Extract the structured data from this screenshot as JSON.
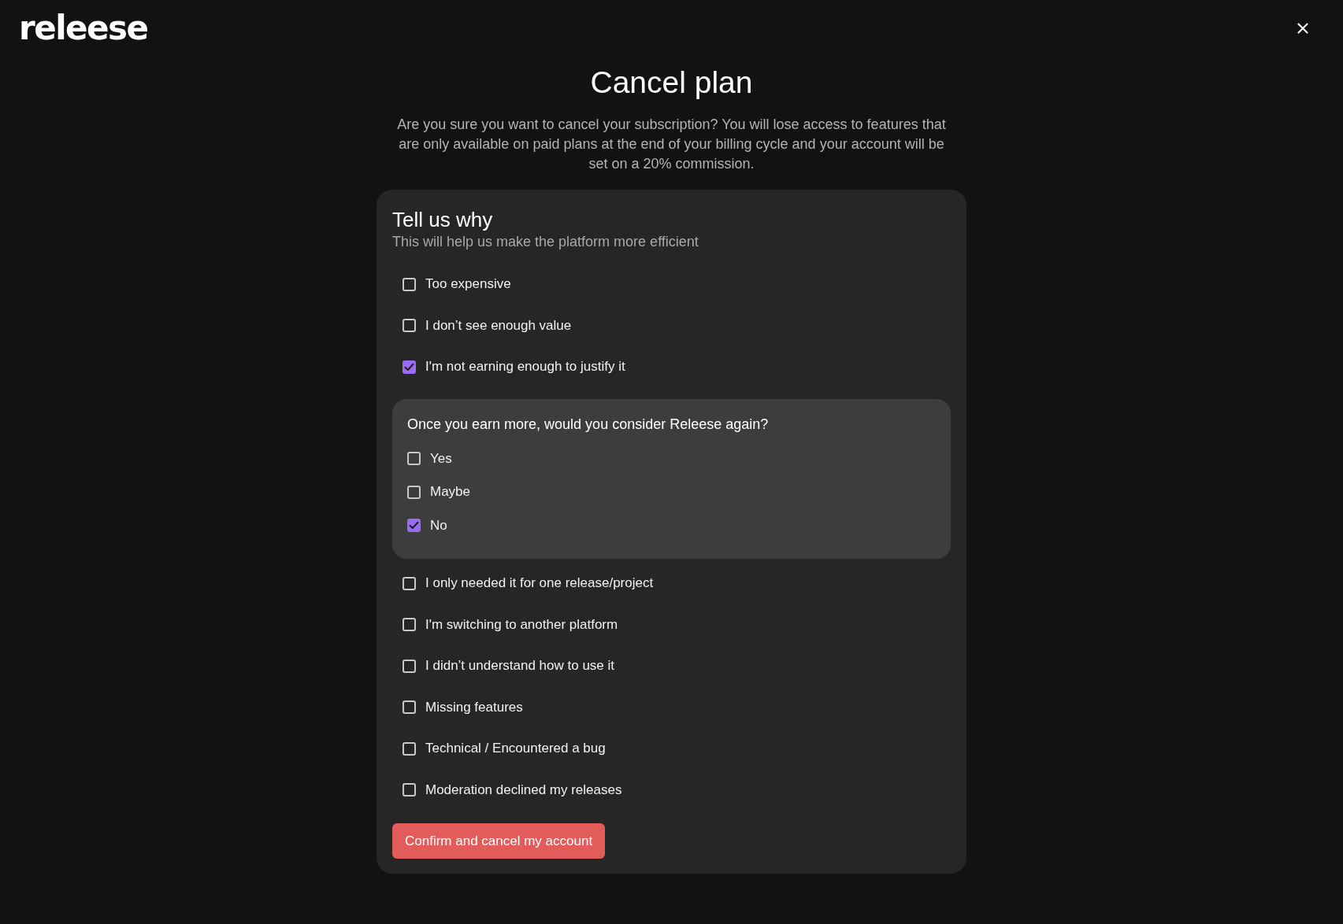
{
  "header": {
    "logo": "releese"
  },
  "title": "Cancel plan",
  "description": "Are you sure you want to cancel your subscription? You will lose access to features that are only available on paid plans at the end of your billing cycle and your account will be set on a 20% commission.",
  "survey": {
    "title": "Tell us why",
    "subtitle": "This will help us make the platform more efficient",
    "options": [
      {
        "label": "Too expensive",
        "checked": false
      },
      {
        "label": "I don’t see enough value",
        "checked": false
      },
      {
        "label": "I'm not earning enough to justify it",
        "checked": true,
        "follow_up": {
          "question": "Once you earn more, would you consider Releese again?",
          "options": [
            {
              "label": "Yes",
              "checked": false
            },
            {
              "label": "Maybe",
              "checked": false
            },
            {
              "label": "No",
              "checked": true
            }
          ]
        }
      },
      {
        "label": "I only needed it for one release/project",
        "checked": false
      },
      {
        "label": "I'm switching to another platform",
        "checked": false
      },
      {
        "label": "I didn’t understand how to use it",
        "checked": false
      },
      {
        "label": "Missing features",
        "checked": false
      },
      {
        "label": "Technical / Encountered a bug",
        "checked": false
      },
      {
        "label": "Moderation declined my releases",
        "checked": false
      }
    ]
  },
  "confirm_button": "Confirm and cancel my account"
}
